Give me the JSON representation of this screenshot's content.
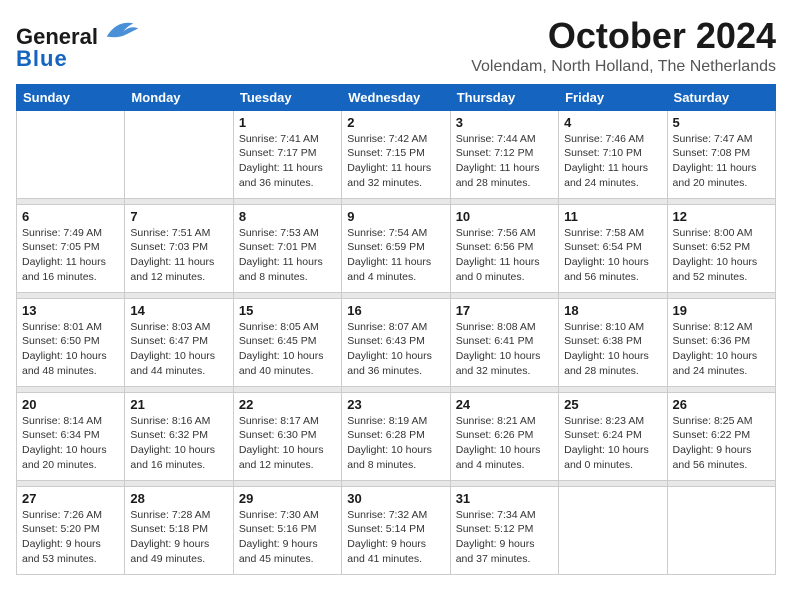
{
  "header": {
    "logo_general": "General",
    "logo_blue": "Blue",
    "month_title": "October 2024",
    "location": "Volendam, North Holland, The Netherlands"
  },
  "weekdays": [
    "Sunday",
    "Monday",
    "Tuesday",
    "Wednesday",
    "Thursday",
    "Friday",
    "Saturday"
  ],
  "weeks": [
    {
      "days": [
        {
          "num": "",
          "detail": ""
        },
        {
          "num": "",
          "detail": ""
        },
        {
          "num": "1",
          "detail": "Sunrise: 7:41 AM\nSunset: 7:17 PM\nDaylight: 11 hours\nand 36 minutes."
        },
        {
          "num": "2",
          "detail": "Sunrise: 7:42 AM\nSunset: 7:15 PM\nDaylight: 11 hours\nand 32 minutes."
        },
        {
          "num": "3",
          "detail": "Sunrise: 7:44 AM\nSunset: 7:12 PM\nDaylight: 11 hours\nand 28 minutes."
        },
        {
          "num": "4",
          "detail": "Sunrise: 7:46 AM\nSunset: 7:10 PM\nDaylight: 11 hours\nand 24 minutes."
        },
        {
          "num": "5",
          "detail": "Sunrise: 7:47 AM\nSunset: 7:08 PM\nDaylight: 11 hours\nand 20 minutes."
        }
      ]
    },
    {
      "days": [
        {
          "num": "6",
          "detail": "Sunrise: 7:49 AM\nSunset: 7:05 PM\nDaylight: 11 hours\nand 16 minutes."
        },
        {
          "num": "7",
          "detail": "Sunrise: 7:51 AM\nSunset: 7:03 PM\nDaylight: 11 hours\nand 12 minutes."
        },
        {
          "num": "8",
          "detail": "Sunrise: 7:53 AM\nSunset: 7:01 PM\nDaylight: 11 hours\nand 8 minutes."
        },
        {
          "num": "9",
          "detail": "Sunrise: 7:54 AM\nSunset: 6:59 PM\nDaylight: 11 hours\nand 4 minutes."
        },
        {
          "num": "10",
          "detail": "Sunrise: 7:56 AM\nSunset: 6:56 PM\nDaylight: 11 hours\nand 0 minutes."
        },
        {
          "num": "11",
          "detail": "Sunrise: 7:58 AM\nSunset: 6:54 PM\nDaylight: 10 hours\nand 56 minutes."
        },
        {
          "num": "12",
          "detail": "Sunrise: 8:00 AM\nSunset: 6:52 PM\nDaylight: 10 hours\nand 52 minutes."
        }
      ]
    },
    {
      "days": [
        {
          "num": "13",
          "detail": "Sunrise: 8:01 AM\nSunset: 6:50 PM\nDaylight: 10 hours\nand 48 minutes."
        },
        {
          "num": "14",
          "detail": "Sunrise: 8:03 AM\nSunset: 6:47 PM\nDaylight: 10 hours\nand 44 minutes."
        },
        {
          "num": "15",
          "detail": "Sunrise: 8:05 AM\nSunset: 6:45 PM\nDaylight: 10 hours\nand 40 minutes."
        },
        {
          "num": "16",
          "detail": "Sunrise: 8:07 AM\nSunset: 6:43 PM\nDaylight: 10 hours\nand 36 minutes."
        },
        {
          "num": "17",
          "detail": "Sunrise: 8:08 AM\nSunset: 6:41 PM\nDaylight: 10 hours\nand 32 minutes."
        },
        {
          "num": "18",
          "detail": "Sunrise: 8:10 AM\nSunset: 6:38 PM\nDaylight: 10 hours\nand 28 minutes."
        },
        {
          "num": "19",
          "detail": "Sunrise: 8:12 AM\nSunset: 6:36 PM\nDaylight: 10 hours\nand 24 minutes."
        }
      ]
    },
    {
      "days": [
        {
          "num": "20",
          "detail": "Sunrise: 8:14 AM\nSunset: 6:34 PM\nDaylight: 10 hours\nand 20 minutes."
        },
        {
          "num": "21",
          "detail": "Sunrise: 8:16 AM\nSunset: 6:32 PM\nDaylight: 10 hours\nand 16 minutes."
        },
        {
          "num": "22",
          "detail": "Sunrise: 8:17 AM\nSunset: 6:30 PM\nDaylight: 10 hours\nand 12 minutes."
        },
        {
          "num": "23",
          "detail": "Sunrise: 8:19 AM\nSunset: 6:28 PM\nDaylight: 10 hours\nand 8 minutes."
        },
        {
          "num": "24",
          "detail": "Sunrise: 8:21 AM\nSunset: 6:26 PM\nDaylight: 10 hours\nand 4 minutes."
        },
        {
          "num": "25",
          "detail": "Sunrise: 8:23 AM\nSunset: 6:24 PM\nDaylight: 10 hours\nand 0 minutes."
        },
        {
          "num": "26",
          "detail": "Sunrise: 8:25 AM\nSunset: 6:22 PM\nDaylight: 9 hours\nand 56 minutes."
        }
      ]
    },
    {
      "days": [
        {
          "num": "27",
          "detail": "Sunrise: 7:26 AM\nSunset: 5:20 PM\nDaylight: 9 hours\nand 53 minutes."
        },
        {
          "num": "28",
          "detail": "Sunrise: 7:28 AM\nSunset: 5:18 PM\nDaylight: 9 hours\nand 49 minutes."
        },
        {
          "num": "29",
          "detail": "Sunrise: 7:30 AM\nSunset: 5:16 PM\nDaylight: 9 hours\nand 45 minutes."
        },
        {
          "num": "30",
          "detail": "Sunrise: 7:32 AM\nSunset: 5:14 PM\nDaylight: 9 hours\nand 41 minutes."
        },
        {
          "num": "31",
          "detail": "Sunrise: 7:34 AM\nSunset: 5:12 PM\nDaylight: 9 hours\nand 37 minutes."
        },
        {
          "num": "",
          "detail": ""
        },
        {
          "num": "",
          "detail": ""
        }
      ]
    }
  ]
}
